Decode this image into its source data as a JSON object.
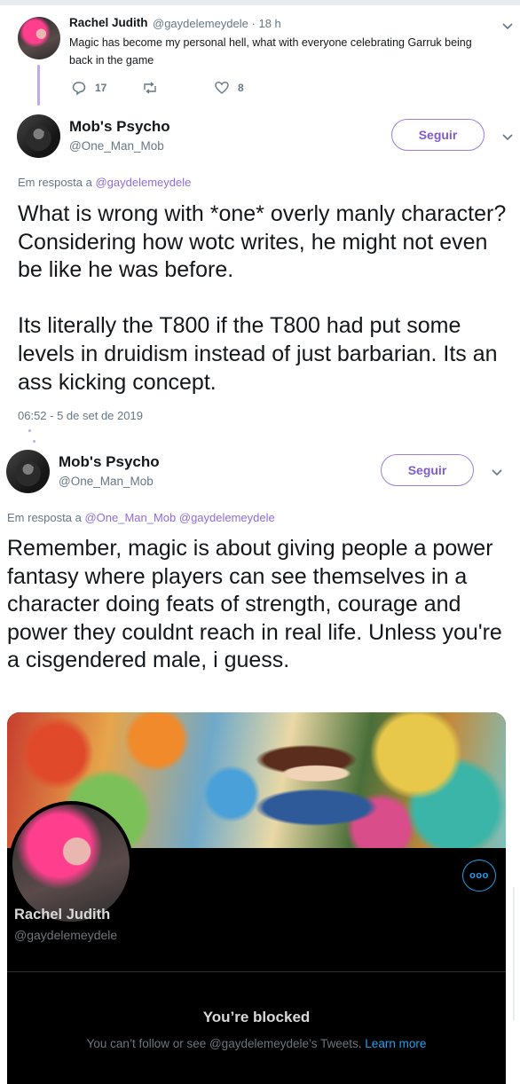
{
  "tweet1": {
    "name": "Rachel Judith",
    "handle": "@gaydelemeydele",
    "separator": "·",
    "time": "18 h",
    "text": "Magic has become my personal hell, what with everyone celebrating Garruk being back in the game",
    "reply_count": "17",
    "like_count": "8"
  },
  "tweet2": {
    "name": "Mob's Psycho",
    "handle": "@One_Man_Mob",
    "follow_label": "Seguir",
    "reply_prefix": "Em resposta a",
    "reply_to": "@gaydelemeydele",
    "text": "What is wrong with *one* overly manly character? Considering how wotc writes, he might not even be like he was before.\n\nIts literally the T800 if the T800 had put some levels in druidism instead of just barbarian. Its an ass kicking concept.",
    "timestamp": "06:52 - 5 de set de 2019"
  },
  "tweet3": {
    "name": "Mob's Psycho",
    "handle": "@One_Man_Mob",
    "follow_label": "Seguir",
    "reply_prefix": "Em resposta a",
    "reply_to": "@One_Man_Mob @gaydelemeydele",
    "text": "Remember, magic is about giving people a power fantasy where players can see themselves in a character doing feats of strength, courage and power they couldnt reach in real life. Unless you're a cisgendered male, i guess."
  },
  "embed": {
    "name": "Rachel Judith",
    "handle": "@gaydelemeydele",
    "more_label": "ooo",
    "blocked_title": "You’re blocked",
    "blocked_text": "You can’t follow or see @gaydelemeydele’s Tweets.",
    "learn_more": "Learn more"
  },
  "colors": {
    "accent_purple": "#8e6be0",
    "twitter_blue": "#1da1f2",
    "muted": "#657786"
  }
}
